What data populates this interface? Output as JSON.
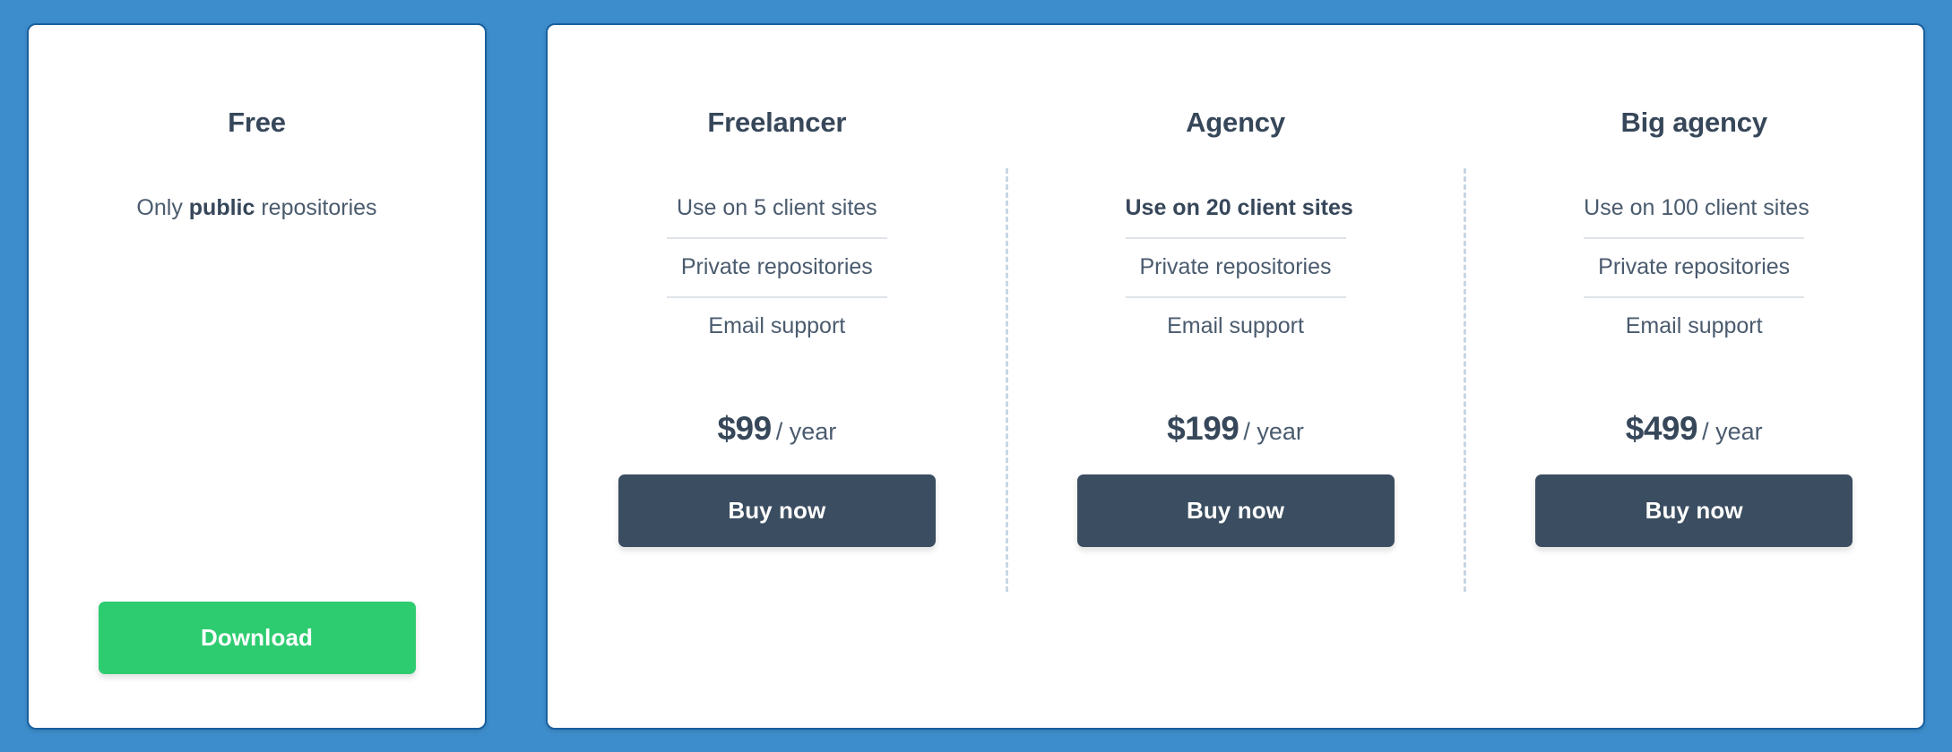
{
  "theme": {
    "page_background": "#3d8dcc",
    "card_background": "#ffffff",
    "card_border": "#1a5f9e",
    "heading_color": "#37475a",
    "text_color": "#4a5b6e",
    "divider_color": "#dfe3e8",
    "dashed_divider_color": "#c9d6e3",
    "buy_button_color": "#3b4d60",
    "download_button_color": "#2ecc71"
  },
  "free_plan": {
    "title": "Free",
    "note_prefix": "Only ",
    "note_highlight": "public",
    "note_suffix": " repositories",
    "download_label": "Download"
  },
  "paid_plans": [
    {
      "title": "Freelancer",
      "features": [
        {
          "label": "Use on 5 client sites",
          "emphasis": false
        },
        {
          "label": "Private repositories",
          "emphasis": false
        },
        {
          "label": "Email support",
          "emphasis": false
        }
      ],
      "price_amount": "$99",
      "price_period": "/ year",
      "buy_label": "Buy now"
    },
    {
      "title": "Agency",
      "features": [
        {
          "label": "Use on 20 client sites",
          "emphasis": true
        },
        {
          "label": "Private repositories",
          "emphasis": false
        },
        {
          "label": "Email support",
          "emphasis": false
        }
      ],
      "price_amount": "$199",
      "price_period": "/ year",
      "buy_label": "Buy now"
    },
    {
      "title": "Big agency",
      "features": [
        {
          "label": "Use on 100 client sites",
          "emphasis": false
        },
        {
          "label": "Private repositories",
          "emphasis": false
        },
        {
          "label": "Email support",
          "emphasis": false
        }
      ],
      "price_amount": "$499",
      "price_period": "/ year",
      "buy_label": "Buy now"
    }
  ]
}
